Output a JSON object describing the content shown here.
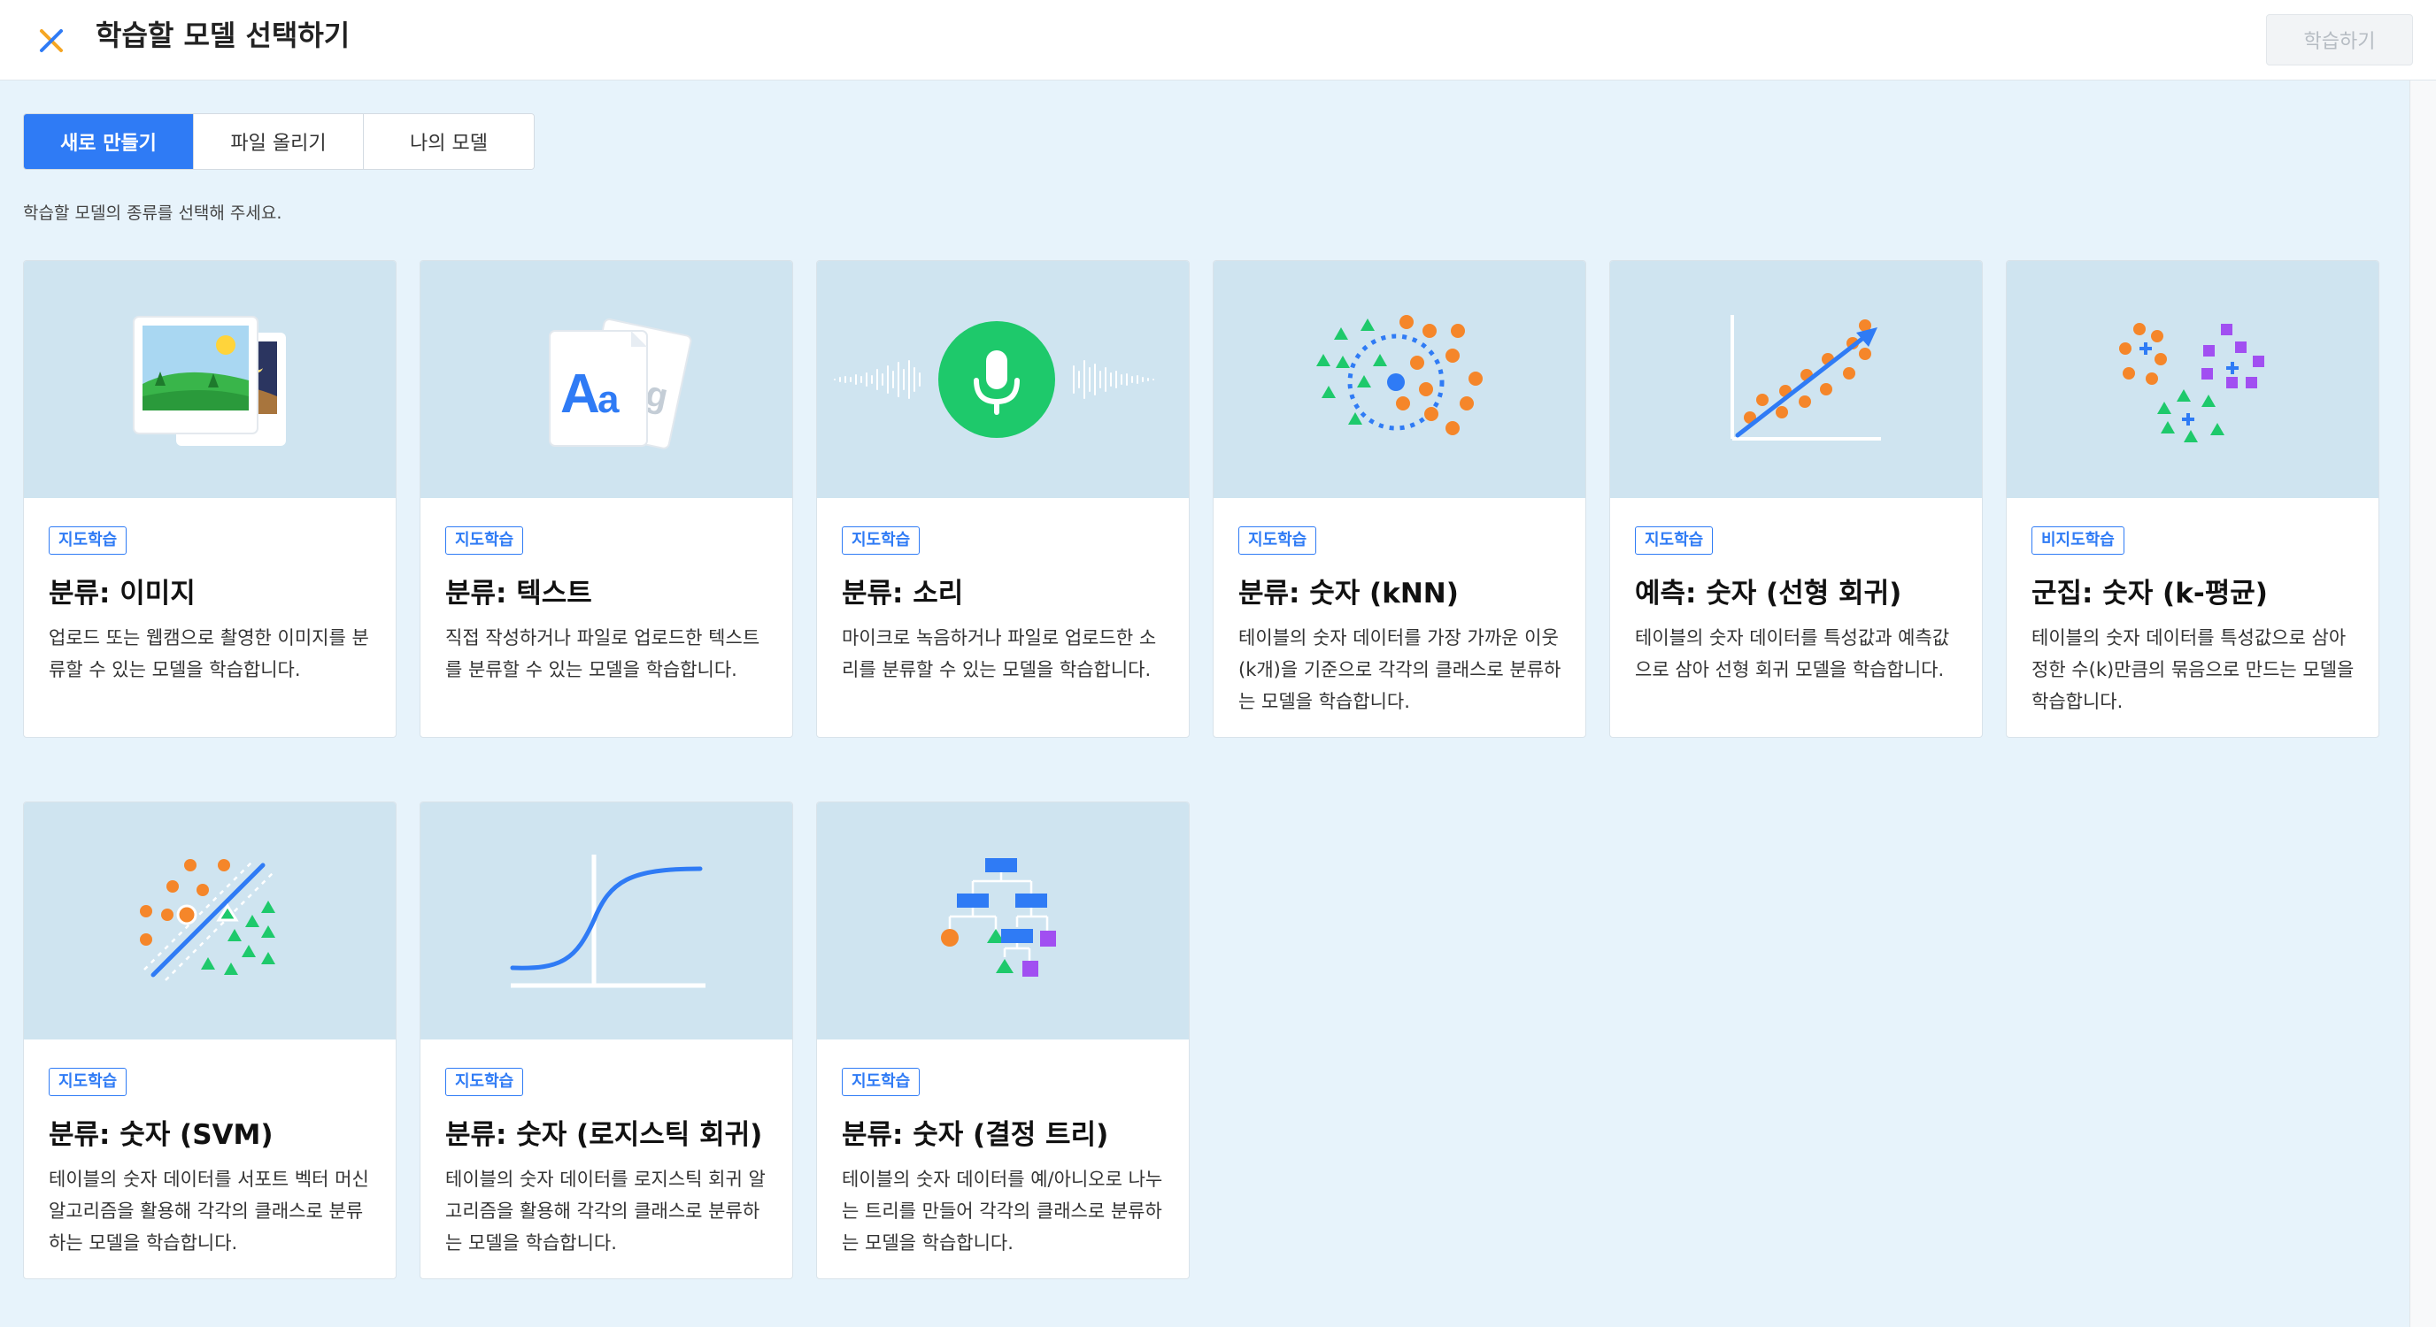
{
  "header": {
    "title": "학습할 모델 선택하기",
    "train_button": "학습하기"
  },
  "colors": {
    "accent": "#2f7bf5",
    "illustration_bg": "#cfe4f0",
    "page_bg": "#e7f3fb",
    "green": "#1ec96b",
    "orange": "#f5862a",
    "purple": "#a14ff1"
  },
  "tabs": [
    {
      "label": "새로 만들기",
      "active": true
    },
    {
      "label": "파일 올리기",
      "active": false
    },
    {
      "label": "나의 모델",
      "active": false
    }
  ],
  "hint": "학습할 모델의 종류를 선택해 주세요.",
  "cards": [
    {
      "badge": "지도학습",
      "title": "분류: 이미지",
      "desc": "업로드 또는 웹캠으로 촬영한 이미지를 분류할 수 있는 모델을 학습합니다.",
      "icon": "image-photos-icon"
    },
    {
      "badge": "지도학습",
      "title": "분류: 텍스트",
      "desc": "직접 작성하거나 파일로 업로드한 텍스트를 분류할 수 있는 모델을 학습합니다.",
      "icon": "text-document-icon"
    },
    {
      "badge": "지도학습",
      "title": "분류: 소리",
      "desc": "마이크로 녹음하거나 파일로 업로드한 소리를 분류할 수 있는 모델을 학습합니다.",
      "icon": "microphone-waveform-icon"
    },
    {
      "badge": "지도학습",
      "title": "분류: 숫자 (kNN)",
      "desc": "테이블의 숫자 데이터를 가장 가까운 이웃(k개)을 기준으로 각각의 클래스로 분류하는 모델을 학습합니다.",
      "icon": "knn-scatter-icon"
    },
    {
      "badge": "지도학습",
      "title": "예측: 숫자 (선형 회귀)",
      "desc": "테이블의 숫자 데이터를 특성값과 예측값으로 삼아 선형 회귀 모델을 학습합니다.",
      "icon": "linear-regression-icon"
    },
    {
      "badge": "비지도학습",
      "title": "군집: 숫자 (k-평균)",
      "desc": "테이블의 숫자 데이터를 특성값으로 삼아 정한 수(k)만큼의 묶음으로 만드는 모델을 학습합니다.",
      "icon": "kmeans-clusters-icon"
    },
    {
      "badge": "지도학습",
      "title": "분류: 숫자 (SVM)",
      "desc": "테이블의 숫자 데이터를 서포트 벡터 머신 알고리즘을 활용해 각각의 클래스로 분류하는 모델을 학습합니다.",
      "icon": "svm-margin-icon"
    },
    {
      "badge": "지도학습",
      "title": "분류: 숫자 (로지스틱 회귀)",
      "desc": "테이블의 숫자 데이터를 로지스틱 회귀 알고리즘을 활용해 각각의 클래스로 분류하는 모델을 학습합니다.",
      "icon": "logistic-curve-icon"
    },
    {
      "badge": "지도학습",
      "title": "분류: 숫자 (결정 트리)",
      "desc": "테이블의 숫자 데이터를 예/아니오로 나누는 트리를 만들어 각각의 클래스로 분류하는 모델을 학습합니다.",
      "icon": "decision-tree-icon"
    }
  ]
}
